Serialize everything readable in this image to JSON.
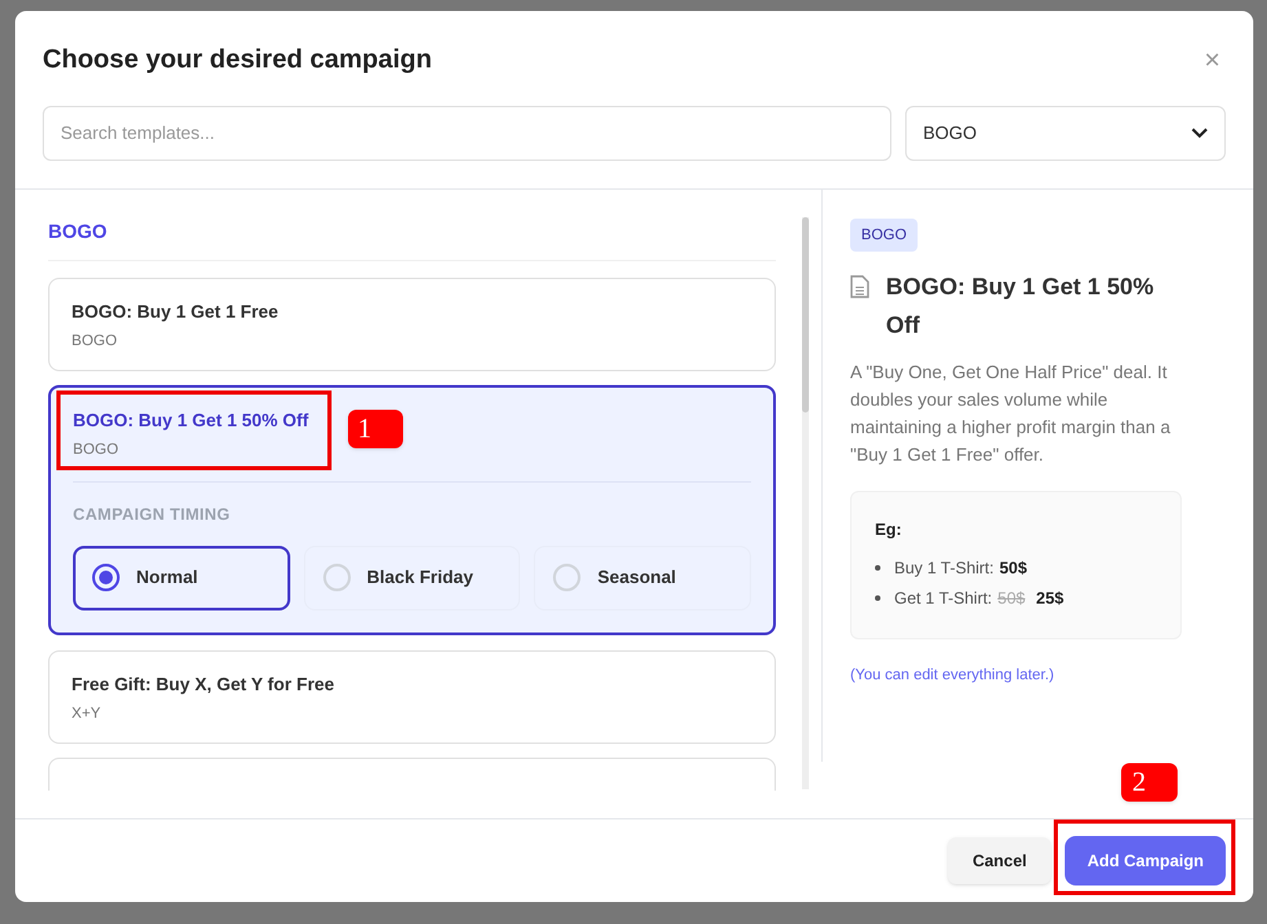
{
  "dialog": {
    "title": "Choose your desired campaign",
    "close": "×"
  },
  "search": {
    "placeholder": "Search templates..."
  },
  "category_select": {
    "value": "BOGO"
  },
  "section": {
    "title": "BOGO"
  },
  "templates": [
    {
      "title": "BOGO: Buy 1 Get 1 Free",
      "tag": "BOGO",
      "selected": false
    },
    {
      "title": "BOGO: Buy 1 Get 1 50% Off",
      "tag": "BOGO",
      "selected": true,
      "timing": {
        "label": "CAMPAIGN TIMING",
        "options": [
          {
            "label": "Normal",
            "selected": true
          },
          {
            "label": "Black Friday",
            "selected": false
          },
          {
            "label": "Seasonal",
            "selected": false
          }
        ]
      }
    },
    {
      "title": "Free Gift: Buy X, Get Y for Free",
      "tag": "X+Y",
      "selected": false
    },
    {
      "selected": false
    }
  ],
  "detail": {
    "badge": "BOGO",
    "title": "BOGO: Buy 1 Get 1 50% Off",
    "description": "A \"Buy One, Get One Half Price\" deal. It doubles your sales volume while maintaining a higher profit margin than a \"Buy 1 Get 1 Free\" offer.",
    "example": {
      "heading": "Eg:",
      "items": [
        {
          "label": "Buy 1 T-Shirt:",
          "price": "50$"
        },
        {
          "label": "Get 1 T-Shirt:",
          "old_price": "50$",
          "price": "25$"
        }
      ]
    },
    "note": "(You can edit everything later.)"
  },
  "footer": {
    "buttons": [
      {
        "label": "Cancel",
        "kind": "secondary"
      },
      {
        "label": "Add Campaign",
        "kind": "primary"
      }
    ]
  },
  "annotations": [
    {
      "label": "1"
    },
    {
      "label": "2"
    }
  ]
}
